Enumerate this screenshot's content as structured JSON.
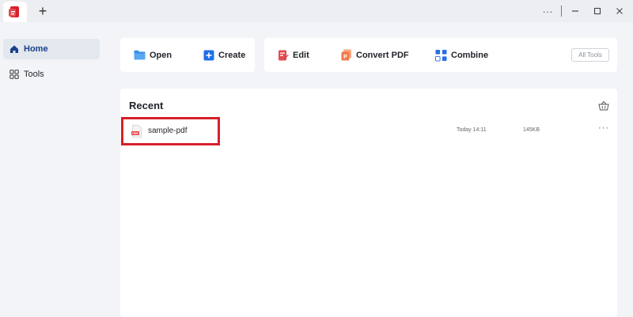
{
  "titlebar": {
    "new_tab": "+",
    "more": "···",
    "minimize": "—",
    "maximize": "☐",
    "close": "✕"
  },
  "sidebar": {
    "items": [
      {
        "label": "Home",
        "icon": "home-icon",
        "active": true
      },
      {
        "label": "Tools",
        "icon": "grid-icon",
        "active": false
      }
    ]
  },
  "toolbar": {
    "open_label": "Open",
    "create_label": "Create",
    "edit_label": "Edit",
    "convert_label": "Convert PDF",
    "combine_label": "Combine",
    "all_tools_label": "All Tools"
  },
  "recent": {
    "title": "Recent",
    "files": [
      {
        "name": "sample-pdf",
        "date": "Today 14:11",
        "size": "145KB",
        "more": "···"
      }
    ]
  },
  "colors": {
    "accent": "#1a3f8a",
    "open_icon": "#3a8ee6",
    "create_icon": "#1f6fe8",
    "edit_icon": "#e5484d",
    "convert_icon": "#f07a4a",
    "combine_icon": "#2b6fe0",
    "highlight": "#d8202a"
  }
}
